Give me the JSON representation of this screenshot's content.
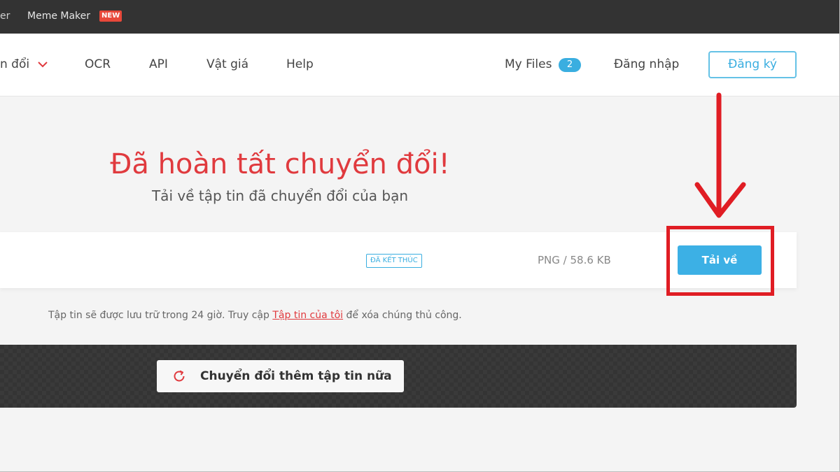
{
  "topbar": {
    "cut_text": "er",
    "meme_label": "Meme Maker",
    "new_badge": "NEW"
  },
  "nav": {
    "convert_label": "n đổi",
    "ocr": "OCR",
    "api": "API",
    "pricing": "Vật giá",
    "help": "Help",
    "my_files": "My Files",
    "my_files_count": "2",
    "login": "Đăng nhập",
    "signup": "Đăng ký"
  },
  "main": {
    "title": "Đã hoàn tất chuyển đổi!",
    "subtitle": "Tải về tập tin đã chuyển đổi của bạn"
  },
  "file": {
    "status": "ĐÃ KẾT THÚC",
    "info": "PNG / 58.6 KB",
    "download_label": "Tải về"
  },
  "note": {
    "before": "Tập tin sẽ được lưu trữ trong 24 giờ. Truy cập ",
    "link": "Tập tin của tôi",
    "after": " để xóa chúng thủ công."
  },
  "bottom": {
    "convert_more": "Chuyển đổi thêm tập tin nữa"
  },
  "colors": {
    "accent_blue": "#3cb0e5",
    "accent_red": "#e03a3e",
    "annotation_red": "#e01d24"
  },
  "icons": {
    "chevron": "chevron-down-icon",
    "refresh": "refresh-icon",
    "arrow": "arrow-down-icon"
  }
}
